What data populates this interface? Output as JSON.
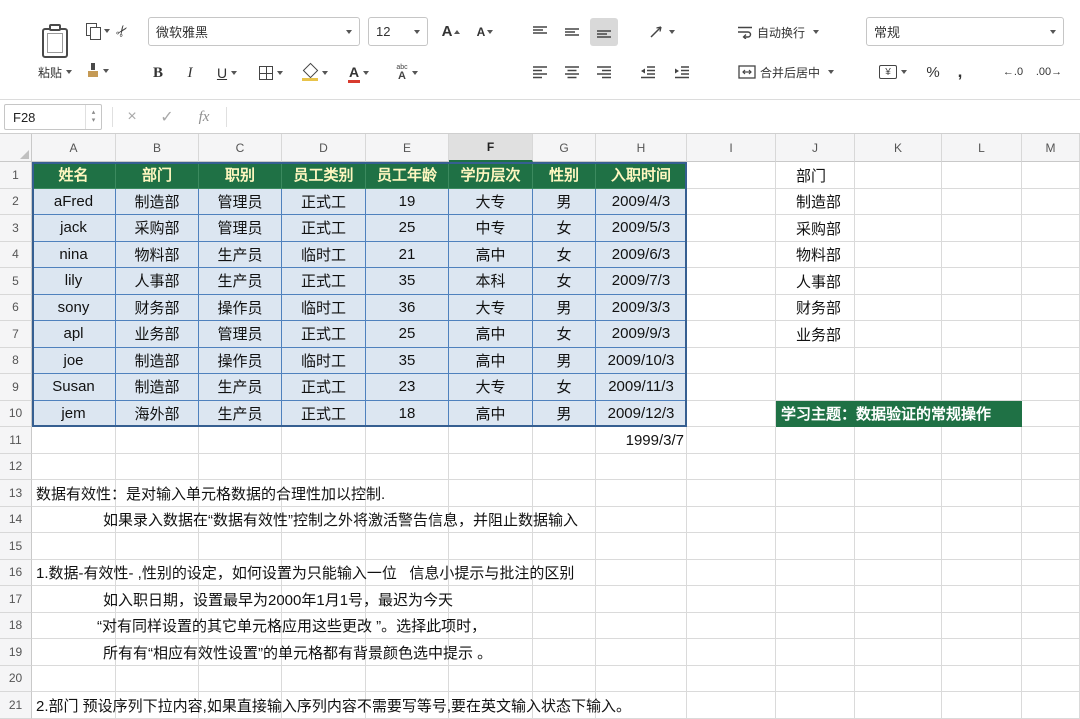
{
  "colors": {
    "accent_green": "#1f7145",
    "table_header_bg": "#1f7145",
    "table_header_text": "#fff7c0",
    "table_cell_bg": "#dce6f1",
    "table_border": "#4f81bd",
    "font_color_swatch": "#d83b2e",
    "fill_color_swatch": "#e8c34a"
  },
  "icons": {
    "cut": "✂",
    "spinner_up": "▴",
    "spinner_down": "▾"
  },
  "ribbon": {
    "paste_label": "粘贴",
    "font_name": "微软雅黑",
    "font_size": "12",
    "bold": "B",
    "italic": "I",
    "underline": "U",
    "grow_font": "A",
    "shrink_font": "A",
    "font_color_letter": "A",
    "phonetic_top": "abc",
    "phonetic_bottom": "A",
    "wrap_label": "自动换行",
    "merge_label": "合并后居中",
    "number_format": "常规",
    "currency": "¥",
    "percent": "%",
    "comma": ",",
    "decimal_increase": "←.0",
    "decimal_decrease": ".00→"
  },
  "formula_bar": {
    "name_box": "F28",
    "cancel": "×",
    "confirm": "✓",
    "fx": "fx"
  },
  "grid": {
    "column_letters": [
      "A",
      "B",
      "C",
      "D",
      "E",
      "F",
      "G",
      "H",
      "I",
      "J",
      "K",
      "L",
      "M"
    ],
    "selected_column": "F",
    "row_count": 21
  },
  "table": {
    "headers": [
      "姓名",
      "部门",
      "职别",
      "员工类别",
      "员工年龄",
      "学历层次",
      "性别",
      "入职时间"
    ],
    "rows": [
      [
        "aFred",
        "制造部",
        "管理员",
        "正式工",
        "19",
        "大专",
        "男",
        "2009/4/3"
      ],
      [
        "jack",
        "采购部",
        "管理员",
        "正式工",
        "25",
        "中专",
        "女",
        "2009/5/3"
      ],
      [
        "nina",
        "物料部",
        "生产员",
        "临时工",
        "21",
        "高中",
        "女",
        "2009/6/3"
      ],
      [
        "lily",
        "人事部",
        "生产员",
        "正式工",
        "35",
        "本科",
        "女",
        "2009/7/3"
      ],
      [
        "sony",
        "财务部",
        "操作员",
        "临时工",
        "36",
        "大专",
        "男",
        "2009/3/3"
      ],
      [
        "apl",
        "业务部",
        "管理员",
        "正式工",
        "25",
        "高中",
        "女",
        "2009/9/3"
      ],
      [
        "joe",
        "制造部",
        "操作员",
        "临时工",
        "35",
        "高中",
        "男",
        "2009/10/3"
      ],
      [
        "Susan",
        "制造部",
        "生产员",
        "正式工",
        "23",
        "大专",
        "女",
        "2009/11/3"
      ],
      [
        "jem",
        "海外部",
        "生产员",
        "正式工",
        "18",
        "高中",
        "男",
        "2009/12/3"
      ]
    ]
  },
  "side_list": {
    "title": "部门",
    "items": [
      "制造部",
      "采购部",
      "物料部",
      "人事部",
      "财务部",
      "业务部"
    ]
  },
  "badge_text": "学习主题：数据验证的常规操作",
  "cells": {
    "date_h11": "1999/3/7"
  },
  "notes": [
    "数据有效性：是对输入单元格数据的合理性加以控制.",
    "如果录入数据在“数据有效性”控制之外将激活警告信息，并阻止数据输入",
    "1.数据-有效性- ,性别的设定，如何设置为只能输入一位   信息小提示与批注的区别",
    "如入职日期，设置最早为2000年1月1号，最迟为今天",
    "“对有同样设置的其它单元格应用这些更改 ”。选择此项时，",
    "所有有“相应有效性设置”的单元格都有背景颜色选中提示 。",
    "2.部门 预设序列下拉内容,如果直接输入序列内容不需要写等号,要在英文输入状态下输入。"
  ]
}
